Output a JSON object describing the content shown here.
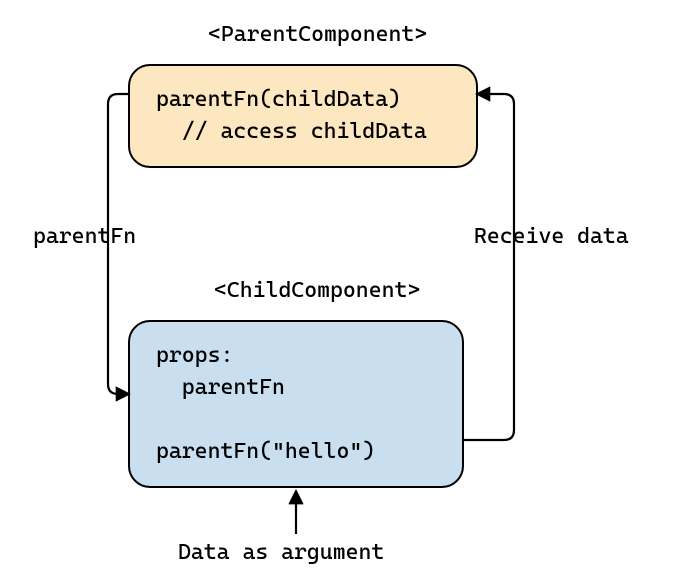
{
  "parent": {
    "title": "<ParentComponent>",
    "line1": "parentFn(childData)",
    "line2": "  // access childData"
  },
  "child": {
    "title": "<ChildComponent>",
    "line1": "props:",
    "line2": "  parentFn",
    "line3": "",
    "line4": "parentFn(\"hello\")"
  },
  "labels": {
    "left": "parentFn",
    "right": "Receive data",
    "bottom": "Data as argument"
  }
}
